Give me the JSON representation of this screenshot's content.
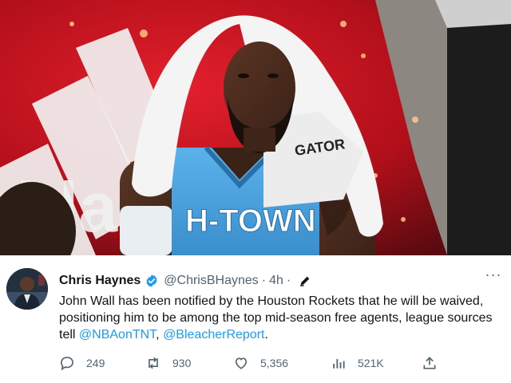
{
  "photo": {
    "jersey_text": "H-TOWN",
    "towel_text": "GATOR",
    "brand_text": "idas"
  },
  "tweet": {
    "author_name": "Chris Haynes",
    "handle": "@ChrisBHaynes",
    "separator": "·",
    "time": "4h",
    "more_label": "···",
    "body_text": "John Wall has been notified by the Houston Rockets that he will be waived, positioning him to be among the top mid-season free agents, league sources tell ",
    "mention_1": "@NBAonTNT",
    "between_mentions": ", ",
    "mention_2": "@BleacherReport",
    "trailing": ".",
    "stats": {
      "replies": "249",
      "retweets": "930",
      "likes": "5,356",
      "views": "521K"
    }
  },
  "colors": {
    "accent": "#1d9bf0",
    "secondary_text": "#536471",
    "primary_text": "#0f1419",
    "jersey_blue": "#4aa3df",
    "backdrop_red": "#c8101e"
  }
}
